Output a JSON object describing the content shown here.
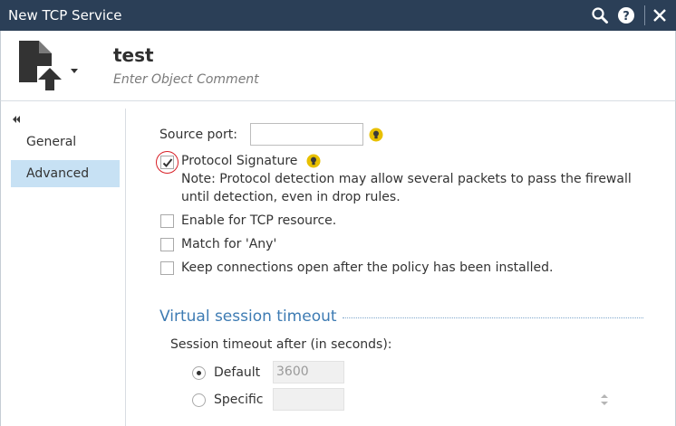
{
  "window": {
    "title": "New TCP Service",
    "title_bar_color": "#2b3f57",
    "buttons": [
      "search-icon",
      "help-icon",
      "close-icon"
    ]
  },
  "object": {
    "name": "test",
    "comment_placeholder": "Enter Object Comment",
    "icon": "service-upload-icon"
  },
  "nav": {
    "items": [
      {
        "label": "General",
        "active": false
      },
      {
        "label": "Advanced",
        "active": true
      }
    ],
    "active_color": "#c7e1f4"
  },
  "advanced": {
    "source_port_label": "Source port:",
    "source_port_value": "",
    "protocol_signature": {
      "label": "Protocol Signature",
      "checked": true,
      "note_line1": "Note: Protocol detection may allow several packets to pass the firewall",
      "note_line2": "until detection, even in drop rules."
    },
    "options": [
      {
        "label": "Enable for TCP resource.",
        "checked": false
      },
      {
        "label": "Match for 'Any'",
        "checked": false
      },
      {
        "label": "Keep connections open after the policy has been installed.",
        "checked": false
      }
    ]
  },
  "session": {
    "title": "Virtual session timeout",
    "title_color": "#3d7bb3",
    "timeout_label": "Session timeout after (in seconds):",
    "default_label": "Default",
    "default_value": "3600",
    "default_selected": true,
    "specific_label": "Specific",
    "specific_value": "",
    "specific_selected": false
  },
  "colors": {
    "highlight_ring": "#d81f26",
    "tip_bulb": "#e8c000"
  }
}
